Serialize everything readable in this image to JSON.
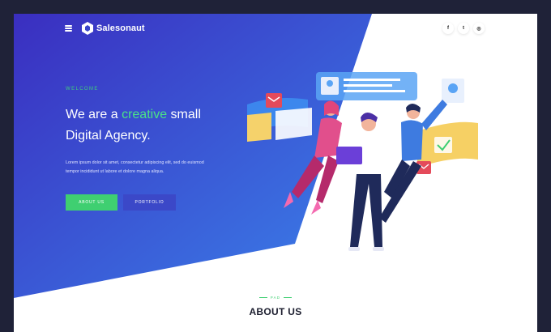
{
  "header": {
    "brand": "Salesonaut",
    "menu_icon": "hamburger-icon",
    "logo_icon": "hexagon-logo-icon",
    "social": [
      {
        "icon": "facebook-icon",
        "glyph": "f"
      },
      {
        "icon": "twitter-icon",
        "glyph": "t"
      },
      {
        "icon": "instagram-icon",
        "glyph": "◎"
      }
    ]
  },
  "hero": {
    "eyebrow": "WELCOME",
    "headline_pre": "We are a ",
    "headline_accent": "creative",
    "headline_post": " small",
    "headline_line2": "Digital Agency.",
    "description_line1": "Lorem ipsum dolor sit amet, consectetur adipiscing elit, sed do euismod",
    "description_line2": "tempor incididunt ut labore et dolore magna aliqua.",
    "primary_button": "ABOUT US",
    "secondary_button": "PORTFOLIO"
  },
  "about": {
    "tag": "PAD",
    "title": "ABOUT US"
  },
  "colors": {
    "hero_start": "#3a2fc2",
    "hero_end": "#3a7de8",
    "accent": "#3fcf71",
    "backdrop": "#1f2238"
  }
}
